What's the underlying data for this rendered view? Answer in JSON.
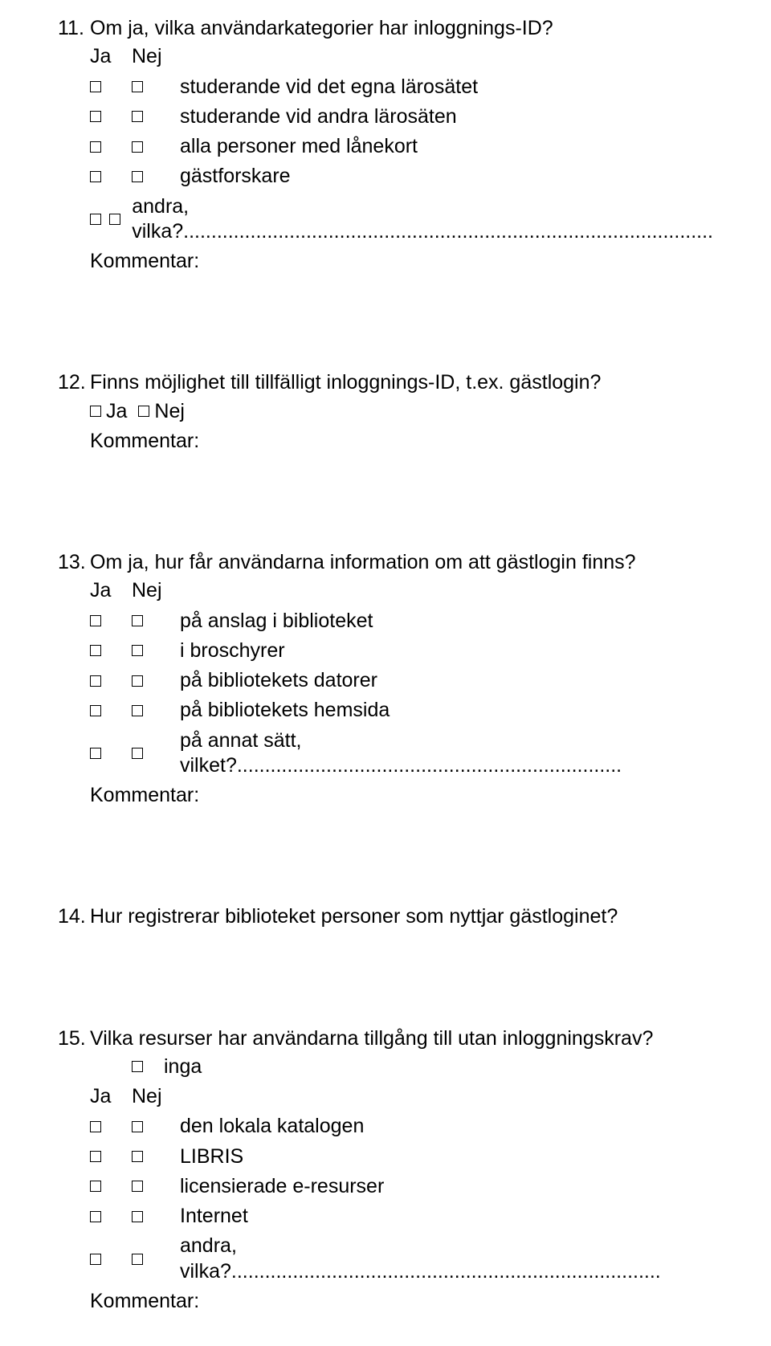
{
  "labels": {
    "ja": "Ja",
    "nej": "Nej",
    "kommentar": "Kommentar:"
  },
  "q11": {
    "number": "11.",
    "title": "Om ja, vilka användarkategorier har inloggnings-ID?",
    "options": [
      "studerande vid det egna lärosätet",
      "studerande vid andra lärosäten",
      "alla personer med lånekort",
      "gästforskare",
      "andra, vilka?..............................................................................................."
    ]
  },
  "q12": {
    "number": "12.",
    "title": "Finns möjlighet till tillfälligt inloggnings-ID, t.ex. gästlogin?"
  },
  "q13": {
    "number": "13.",
    "title": "Om ja, hur får användarna information om att gästlogin finns?",
    "options": [
      "på anslag i biblioteket",
      "i broschyrer",
      "på bibliotekets datorer",
      "på bibliotekets hemsida",
      "på annat sätt, vilket?....................................................................."
    ]
  },
  "q14": {
    "number": "14.",
    "title": "Hur registrerar biblioteket personer som nyttjar gästloginet?"
  },
  "q15": {
    "number": "15.",
    "title": "Vilka resurser har användarna tillgång till utan inloggningskrav?",
    "inga": "inga",
    "options": [
      "den lokala katalogen",
      "LIBRIS",
      "licensierade e-resurser",
      "Internet",
      "andra, vilka?............................................................................."
    ]
  }
}
